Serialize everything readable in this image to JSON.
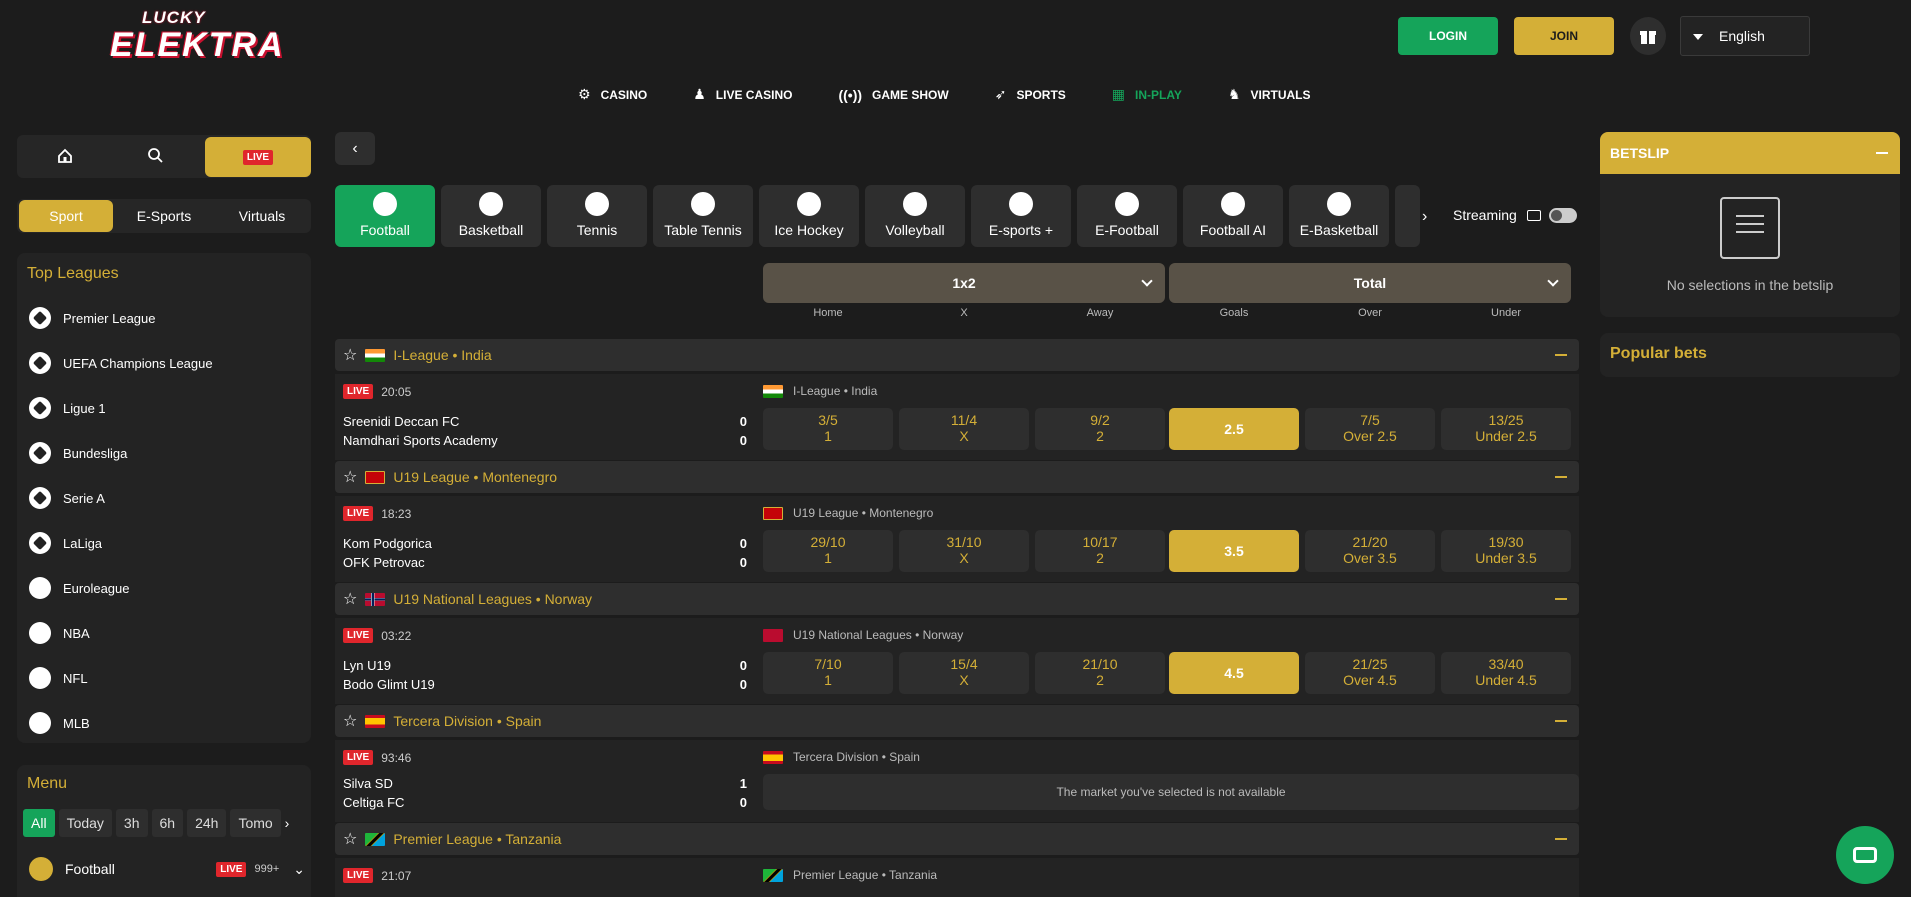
{
  "header": {
    "logo_top": "LUCKY",
    "logo_main": "ELEKTRA",
    "login": "LOGIN",
    "join": "JOIN",
    "language": "English"
  },
  "topnav": [
    {
      "label": "CASINO",
      "icon": "casino-chip-icon"
    },
    {
      "label": "LIVE CASINO",
      "icon": "live-dealer-icon"
    },
    {
      "label": "GAME SHOW",
      "icon": "broadcast-icon"
    },
    {
      "label": "SPORTS",
      "icon": "sports-icon"
    },
    {
      "label": "IN-PLAY",
      "icon": "in-play-icon",
      "active": true
    },
    {
      "label": "VIRTUALS",
      "icon": "virtuals-icon"
    }
  ],
  "sidebar": {
    "live_label": "LIVE",
    "tabs": [
      "Sport",
      "E-Sports",
      "Virtuals"
    ],
    "top_leagues_title": "Top Leagues",
    "top_leagues": [
      "Premier League",
      "UEFA Champions League",
      "Ligue 1",
      "Bundesliga",
      "Serie A",
      "LaLiga",
      "Euroleague",
      "NBA",
      "NFL",
      "MLB"
    ],
    "menu_title": "Menu",
    "menu_filters": [
      "All",
      "Today",
      "3h",
      "6h",
      "24h",
      "Tomo"
    ],
    "menu_football": {
      "label": "Football",
      "live": "LIVE",
      "count": "999+"
    }
  },
  "sport_tabs": [
    "Football",
    "Basketball",
    "Tennis",
    "Table Tennis",
    "Ice Hockey",
    "Volleyball",
    "E-sports +",
    "E-Football",
    "Football AI",
    "E-Basketball"
  ],
  "streaming_label": "Streaming",
  "markets": {
    "market1": "1x2",
    "market2": "Total",
    "cols": [
      "Home",
      "X",
      "Away",
      "Goals",
      "Over",
      "Under"
    ]
  },
  "leagues": [
    {
      "name": "I-League • India",
      "match": {
        "live": "LIVE",
        "time": "20:05",
        "league": "I-League • India",
        "home": "Sreenidi Deccan FC",
        "away": "Namdhari Sports Academy",
        "home_score": "0",
        "away_score": "0",
        "odds": [
          {
            "v": "3/5",
            "l": "1"
          },
          {
            "v": "11/4",
            "l": "X"
          },
          {
            "v": "9/2",
            "l": "2"
          },
          {
            "v": "2.5",
            "l": ""
          },
          {
            "v": "7/5",
            "l": "Over 2.5"
          },
          {
            "v": "13/25",
            "l": "Under 2.5"
          }
        ]
      }
    },
    {
      "name": "U19 League • Montenegro",
      "match": {
        "live": "LIVE",
        "time": "18:23",
        "league": "U19 League • Montenegro",
        "home": "Kom Podgorica",
        "away": "OFK Petrovac",
        "home_score": "0",
        "away_score": "0",
        "odds": [
          {
            "v": "29/10",
            "l": "1"
          },
          {
            "v": "31/10",
            "l": "X"
          },
          {
            "v": "10/17",
            "l": "2"
          },
          {
            "v": "3.5",
            "l": ""
          },
          {
            "v": "21/20",
            "l": "Over 3.5"
          },
          {
            "v": "19/30",
            "l": "Under 3.5"
          }
        ]
      }
    },
    {
      "name": "U19 National Leagues • Norway",
      "match": {
        "live": "LIVE",
        "time": "03:22",
        "league": "U19 National Leagues • Norway",
        "home": "Lyn U19",
        "away": "Bodo Glimt U19",
        "home_score": "0",
        "away_score": "0",
        "odds": [
          {
            "v": "7/10",
            "l": "1"
          },
          {
            "v": "15/4",
            "l": "X"
          },
          {
            "v": "21/10",
            "l": "2"
          },
          {
            "v": "4.5",
            "l": ""
          },
          {
            "v": "21/25",
            "l": "Over 4.5"
          },
          {
            "v": "33/40",
            "l": "Under 4.5"
          }
        ]
      }
    },
    {
      "name": "Tercera Division • Spain",
      "match": {
        "live": "LIVE",
        "time": "93:46",
        "league": "Tercera Division • Spain",
        "home": "Silva SD",
        "away": "Celtiga FC",
        "home_score": "1",
        "away_score": "0",
        "unavailable": "The market you've selected is not available"
      }
    },
    {
      "name": "Premier League • Tanzania",
      "match": {
        "live": "LIVE",
        "time": "21:07",
        "league": "Premier League • Tanzania"
      }
    }
  ],
  "betslip": {
    "title": "BETSLIP",
    "empty": "No selections in the betslip",
    "popular": "Popular bets"
  },
  "colors": {
    "gold": "#d4af37",
    "green": "#15a45a",
    "live_red": "#e0262c",
    "background": "#1c1c1c"
  }
}
